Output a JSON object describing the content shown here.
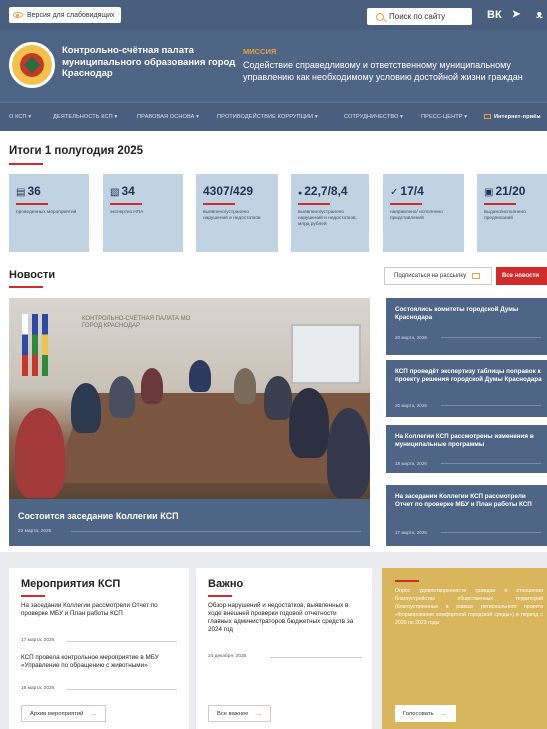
{
  "topbar": {
    "vision_label": "Версия для слабовидящих",
    "search_label": "Поиск по сайту",
    "social": [
      "ВК",
      "TG",
      "OK"
    ]
  },
  "header": {
    "org_name": "Контрольно-счётная палата муниципального образования город Краснодар",
    "mission_title": "МИССИЯ",
    "mission_text": "Содействие справедливому и ответственному муниципальному управлению как необходимому условию достойной жизни граждан"
  },
  "nav": {
    "items": [
      "О КСП ▾",
      "ДЕЯТЕЛЬНОСТЬ КСП ▾",
      "ПРАВОВАЯ ОСНОВА ▾",
      "ПРОТИВОДЕЙСТВИЕ КОРРУПЦИИ ▾",
      "СОТРУДНИЧЕСТВО ▾",
      "ПРЕСС-ЦЕНТР ▾",
      "Интернет-приём"
    ]
  },
  "results": {
    "title": "Итоги 1 полугодия 2025",
    "stats": [
      {
        "icon": "calendar-icon",
        "glyph": "▤",
        "value": "36",
        "label": "проведенных мероприятий"
      },
      {
        "icon": "document-icon",
        "glyph": "▧",
        "value": "34",
        "label": "экспертиз НПА"
      },
      {
        "icon": "none",
        "glyph": "",
        "value": "4307/429",
        "label": "выявлено/устранено нарушений и недостатков"
      },
      {
        "icon": "coin-icon",
        "glyph": "●",
        "value": "22,7/8,4",
        "label": "выявлено/устранено нарушений и недостатков, млрд рублей"
      },
      {
        "icon": "check-icon",
        "glyph": "✓",
        "value": "17/4",
        "label": "направлено/ исполнено представлений"
      },
      {
        "icon": "clipboard-icon",
        "glyph": "▣",
        "value": "21/20",
        "label": "выдано/исполнено предписаний"
      }
    ]
  },
  "news": {
    "title": "Новости",
    "subscribe_label": "Подписаться на рассылку",
    "all_label": "Все новости",
    "main": {
      "photo_caption": "КОНТРОЛЬНО-СЧЁТНАЯ ПАЛАТА МО ГОРОД КРАСНОДАР",
      "title": "Состоится заседание Коллегии КСП",
      "date": "22 марта, 2026"
    },
    "side": [
      {
        "title": "Состоялись комитеты городской Думы Краснодара",
        "date": "20 марта, 2026"
      },
      {
        "title": "КСП проведёт экспертизу таблицы поправок к проекту решения городской Думы Краснодара",
        "date": "20 марта, 2026"
      },
      {
        "title": "На Коллегии КСП рассмотрены изменения в муниципальные программы",
        "date": "18 марта, 2026"
      },
      {
        "title": "На заседании Коллегии КСП рассмотрели Отчет по проверке МБУ и План работы КСП",
        "date": "17 марта, 2026"
      }
    ]
  },
  "events": {
    "title": "Мероприятия КСП",
    "items": [
      {
        "title": "На заседании Коллегии рассмотрели Отчет по проверке МБУ и План работы КСП",
        "date": "17 марта, 2026"
      },
      {
        "title": "КСП провела контрольное мероприятие в МБУ «Управление по обращению с животными»",
        "date": "16 марта, 2026"
      }
    ],
    "archive_label": "Архив мероприятий"
  },
  "important": {
    "title": "Важно",
    "item_title": "Обзор нарушений и недостатков, выявленных в ходе внешней проверки годовой отчетности главных администраторов бюджетных средств за 2024 год",
    "item_date": "24 декабря, 2025",
    "all_label": "Все важное"
  },
  "poll": {
    "text": "Опрос удовлетворенности граждан в отношении благоустройства общественных территорий (благоустроенных в рамках регионального проекта «Формирование комфортной городской среды») в период с 2020 по 2023 годы",
    "vote_label": "Голосовать"
  },
  "colors": {
    "navy": "#4a5e7d",
    "accent": "#e7a23a",
    "red": "#d22b2b",
    "stat_bg": "#c0d3e2",
    "poll_bg": "#d9b55b"
  }
}
